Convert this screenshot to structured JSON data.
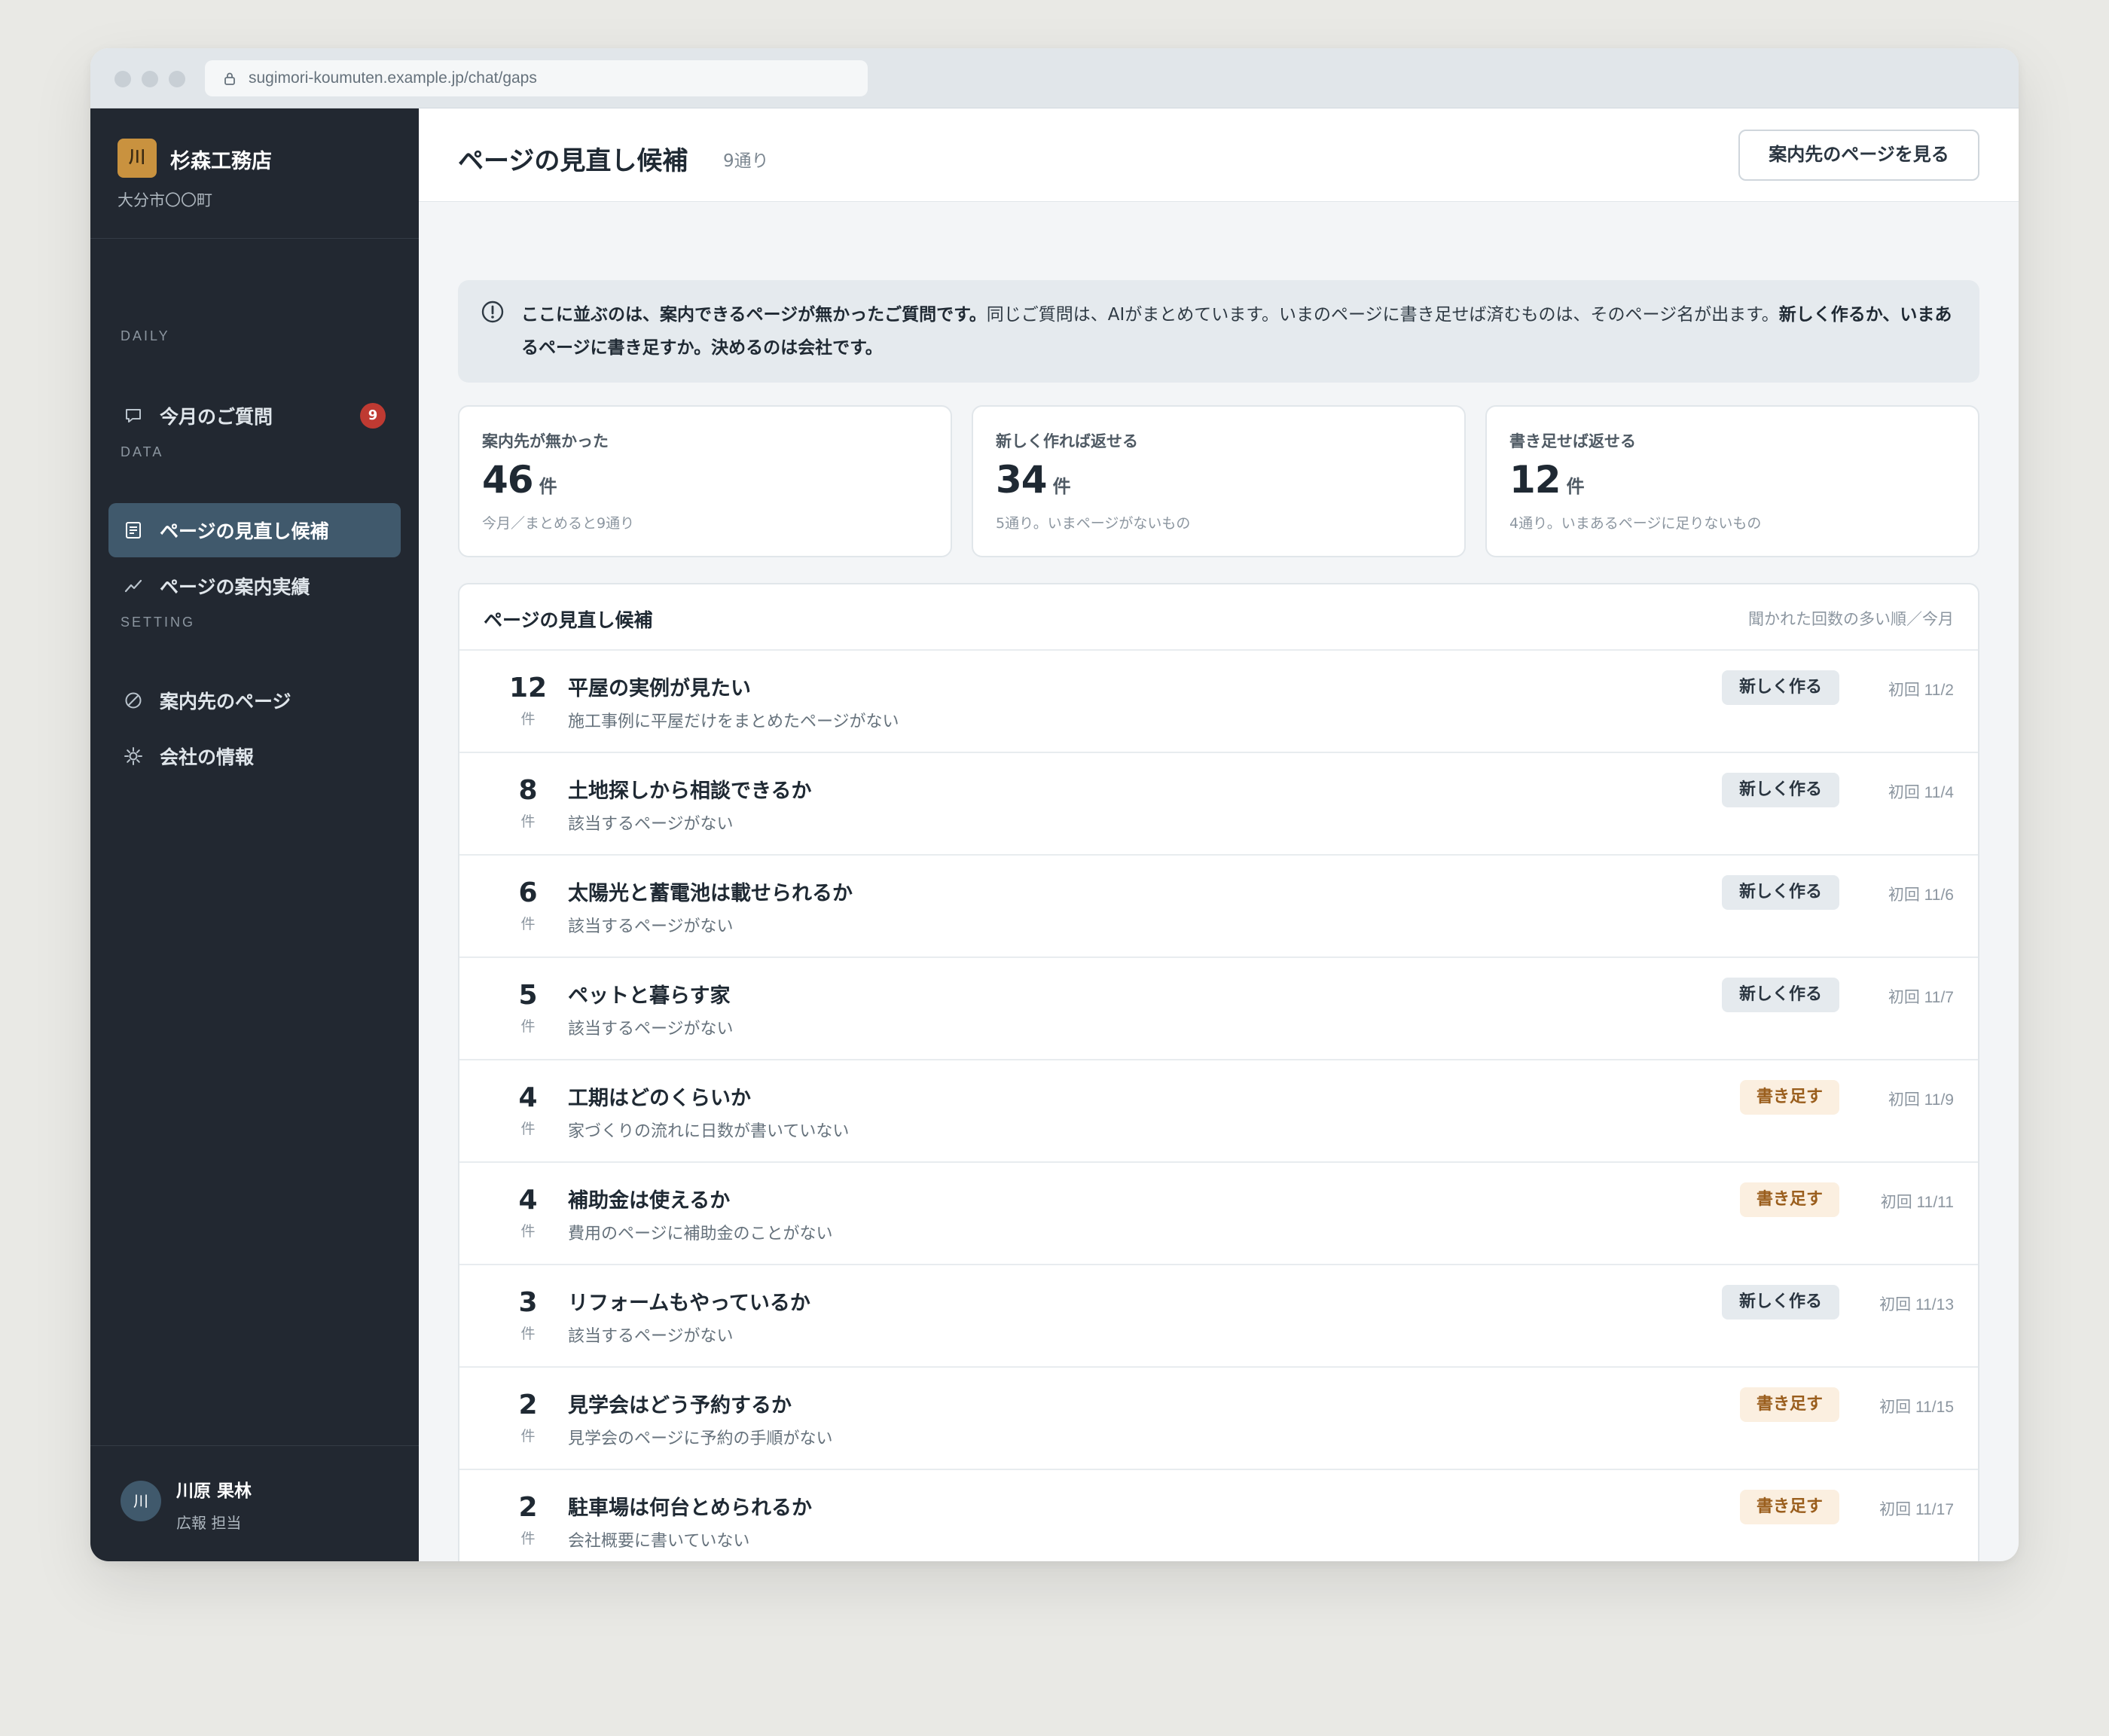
{
  "browser": {
    "url": "sugimori-koumuten.example.jp/chat/gaps"
  },
  "sidebar": {
    "brand_initial": "川",
    "brand_name": "杉森工務店",
    "brand_location": "大分市〇〇町",
    "sections": {
      "daily": "DAILY",
      "data": "DATA",
      "setting": "SETTING"
    },
    "items": [
      {
        "label": "今月のご質問",
        "icon": "chat-bubble-icon",
        "badge": "9"
      },
      {
        "label": "ページの見直し候補",
        "icon": "document-icon",
        "active": true
      },
      {
        "label": "ページの案内実績",
        "icon": "trend-line-icon"
      },
      {
        "label": "案内先のページ",
        "icon": "circle-slash-icon"
      },
      {
        "label": "会社の情報",
        "icon": "gear-icon"
      }
    ],
    "user": {
      "initial": "川",
      "name": "川原 果林",
      "role": "広報 担当"
    }
  },
  "header": {
    "title": "ページの見直し候補",
    "count": "9通り",
    "button_label": "案内先のページを見る"
  },
  "notice": {
    "part1": "ここに並ぶのは、案内できるページが無かったご質問です。",
    "part2": "同じご質問は、AIがまとめています。いまのページに書き足せば済むものは、そのページ名が出ます。",
    "part3": "新しく作るか、いまあるページに書き足すか。決めるのは会社です。"
  },
  "stats": [
    {
      "label": "案内先が無かった",
      "value": "46",
      "unit": "件",
      "sub": "今月／まとめると9通り"
    },
    {
      "label": "新しく作れば返せる",
      "value": "34",
      "unit": "件",
      "sub": "5通り。いまページがないもの"
    },
    {
      "label": "書き足せば返せる",
      "value": "12",
      "unit": "件",
      "sub": "4通り。いまあるページに足りないもの"
    }
  ],
  "list": {
    "title": "ページの見直し候補",
    "sort_label": "聞かれた回数の多い順／今月",
    "unit": "件",
    "rows": [
      {
        "count": "12",
        "title": "平屋の実例が見たい",
        "sub": "施工事例に平屋だけをまとめたページがない",
        "tag": "新しく作る",
        "tag_type": "new",
        "date": "初回 11/2"
      },
      {
        "count": "8",
        "title": "土地探しから相談できるか",
        "sub": "該当するページがない",
        "tag": "新しく作る",
        "tag_type": "new",
        "date": "初回 11/4"
      },
      {
        "count": "6",
        "title": "太陽光と蓄電池は載せられるか",
        "sub": "該当するページがない",
        "tag": "新しく作る",
        "tag_type": "new",
        "date": "初回 11/6"
      },
      {
        "count": "5",
        "title": "ペットと暮らす家",
        "sub": "該当するページがない",
        "tag": "新しく作る",
        "tag_type": "new",
        "date": "初回 11/7"
      },
      {
        "count": "4",
        "title": "工期はどのくらいか",
        "sub": "家づくりの流れに日数が書いていない",
        "tag": "書き足す",
        "tag_type": "add",
        "date": "初回 11/9"
      },
      {
        "count": "4",
        "title": "補助金は使えるか",
        "sub": "費用のページに補助金のことがない",
        "tag": "書き足す",
        "tag_type": "add",
        "date": "初回 11/11"
      },
      {
        "count": "3",
        "title": "リフォームもやっているか",
        "sub": "該当するページがない",
        "tag": "新しく作る",
        "tag_type": "new",
        "date": "初回 11/13"
      },
      {
        "count": "2",
        "title": "見学会はどう予約するか",
        "sub": "見学会のページに予約の手順がない",
        "tag": "書き足す",
        "tag_type": "add",
        "date": "初回 11/15"
      },
      {
        "count": "2",
        "title": "駐車場は何台とめられるか",
        "sub": "会社概要に書いていない",
        "tag": "書き足す",
        "tag_type": "add",
        "date": "初回 11/17"
      }
    ]
  },
  "colors": {
    "sidebar_bg": "#222831",
    "active_nav": "#40596c",
    "badge": "#bf3a32",
    "brand_logo": "#c9923f",
    "tag_new_bg": "#e5eaee",
    "tag_add_bg": "#fbefe0",
    "tag_add_text": "#9a5e1d"
  }
}
